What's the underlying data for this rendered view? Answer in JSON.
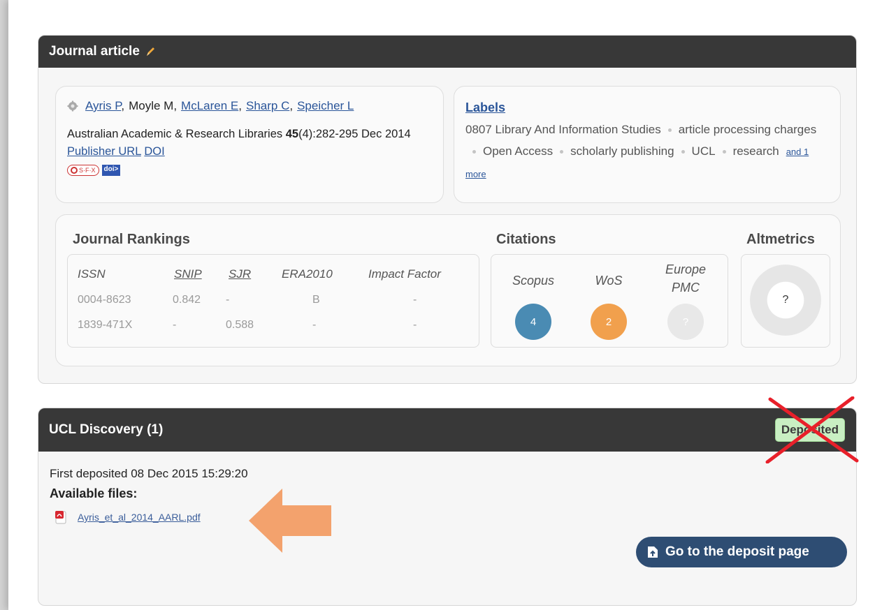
{
  "article": {
    "header_title": "Journal article",
    "authors": [
      {
        "name": "Ayris P",
        "link": true,
        "sep": ","
      },
      {
        "name": "Moyle M",
        "link": false,
        "sep": ","
      },
      {
        "name": "McLaren E",
        "link": true,
        "sep": ","
      },
      {
        "name": "Sharp C",
        "link": true,
        "sep": ","
      },
      {
        "name": "Speicher L",
        "link": true,
        "sep": ""
      }
    ],
    "citation_journal": "Australian Academic & Research Libraries",
    "citation_volume": "45",
    "citation_issue_pages": "(4):282-295 Dec",
    "citation_year": "2014",
    "publisher_url_label": "Publisher URL",
    "doi_label": "DOI",
    "sfx_label": "S·F·X",
    "doi_badge": "doi>"
  },
  "labels": {
    "title": "Labels",
    "items": [
      "0807 Library And Information Studies",
      "article processing charges",
      "Open Access",
      "scholarly publishing",
      "UCL",
      "research"
    ],
    "more_link": "and 1 more"
  },
  "rankings": {
    "title": "Journal Rankings",
    "columns": [
      "ISSN",
      "SNIP",
      "SJR",
      "ERA2010",
      "Impact Factor"
    ],
    "rows": [
      [
        "0004-8623",
        "0.842",
        "-",
        "B",
        "-"
      ],
      [
        "1839-471X",
        "-",
        "0.588",
        "-",
        "-"
      ]
    ]
  },
  "citations": {
    "title": "Citations",
    "sources": [
      {
        "label_line1": "Scopus",
        "label_line2": "",
        "count": "4",
        "color": "#4a8bb3"
      },
      {
        "label_line1": "WoS",
        "label_line2": "",
        "count": "2",
        "color": "#f1a04d"
      },
      {
        "label_line1": "Europe",
        "label_line2": "PMC",
        "count": "?",
        "color": "#e8e8e8"
      }
    ]
  },
  "altmetrics": {
    "title": "Altmetrics",
    "score": "?"
  },
  "discovery": {
    "header_title": "UCL Discovery (1)",
    "status_badge": "Deposited",
    "first_deposited": "First deposited 08 Dec 2015 15:29:20",
    "available_files_label": "Available files:",
    "file_name": "Ayris_et_al_2014_AARL.pdf",
    "deposit_button": "Go to the deposit page"
  },
  "colors": {
    "header_bg": "#383838",
    "link": "#2a5599",
    "badge_bg": "#c9efc3",
    "annotation_arrow": "#f3a26d",
    "annotation_cross": "#e8202a"
  }
}
